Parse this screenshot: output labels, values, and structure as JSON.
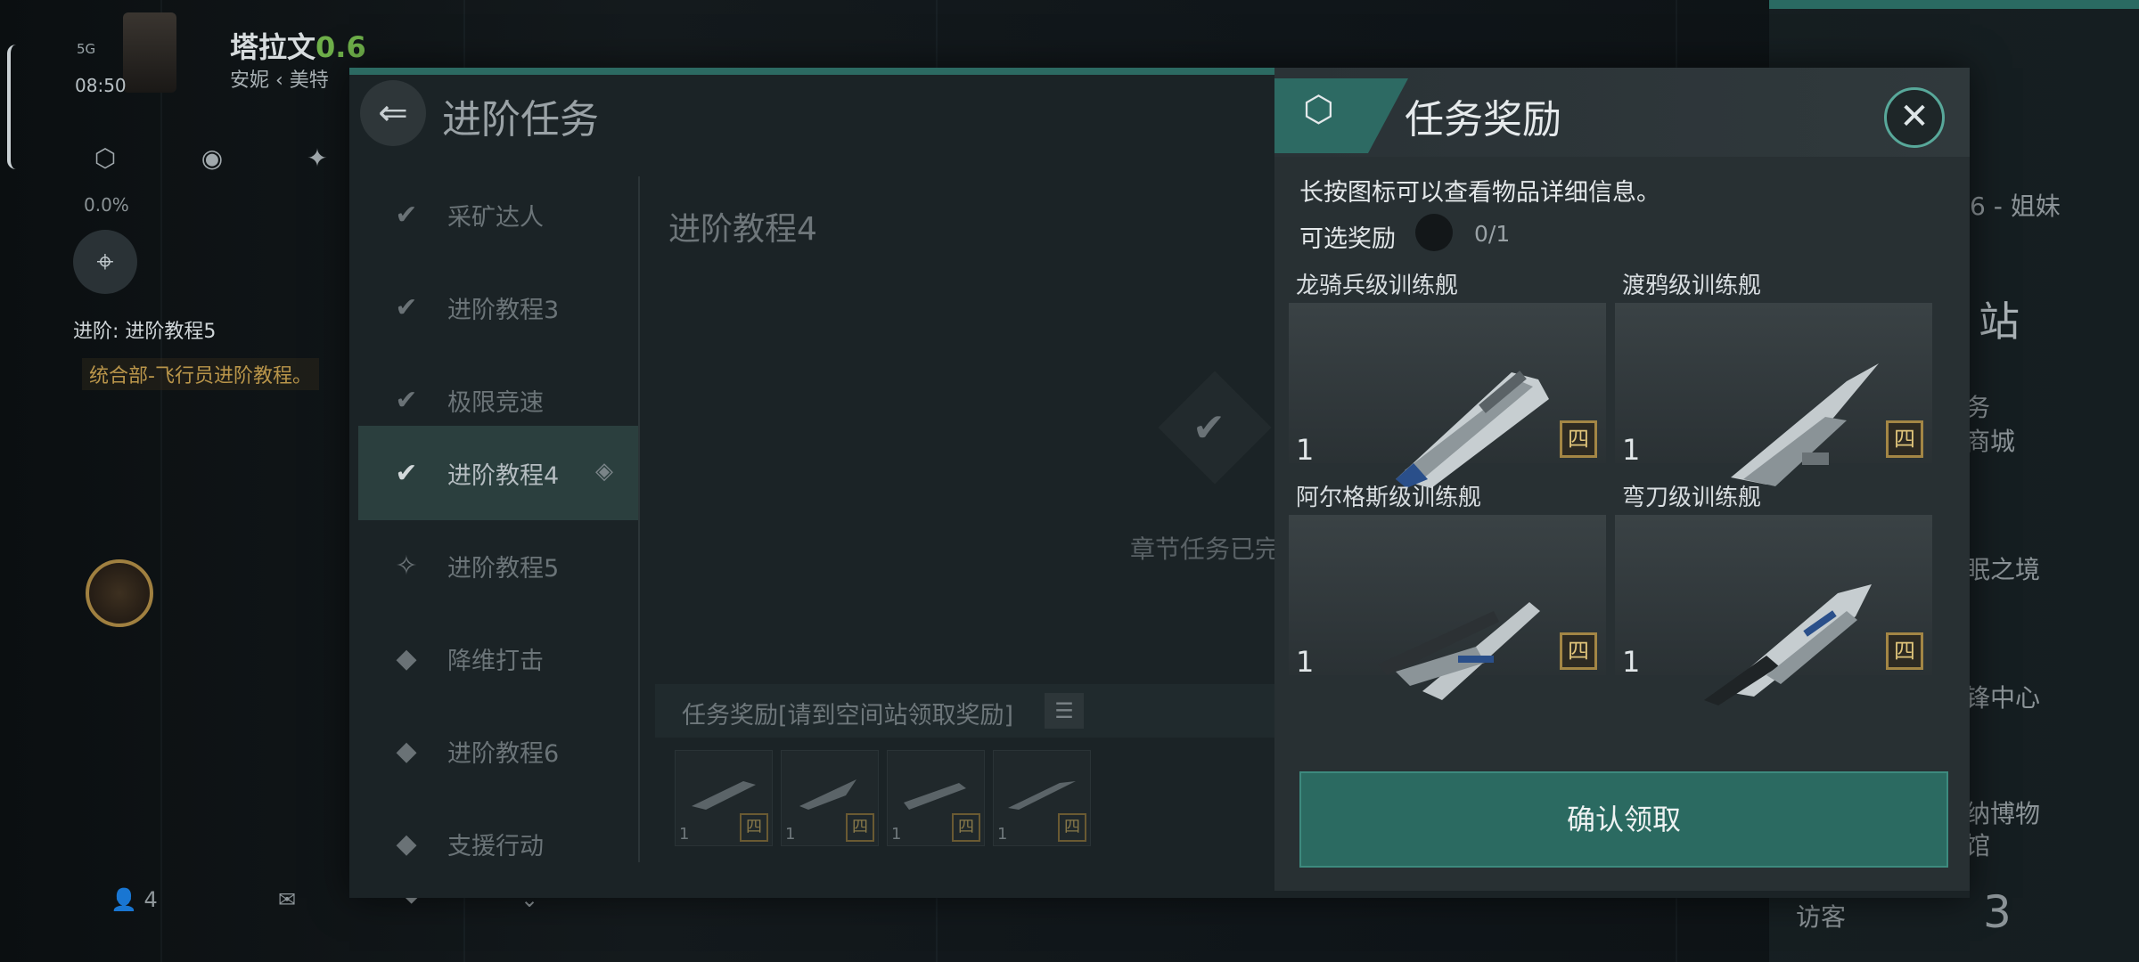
{
  "hud": {
    "signal": "5G",
    "time": "08:50",
    "player_name": "塔拉文",
    "security": "0.6",
    "location": "安妮 ‹ 美特",
    "progress": "0.0%",
    "tracker_title": "进阶: 进阶教程5",
    "tracker_desc": "统合部-飞行员进阶教程。"
  },
  "bottom_bar": {
    "people_count": "4"
  },
  "right_bg": {
    "text_1": "6 - 姐妹",
    "text_2": "站",
    "text_3": "务",
    "text_4": "商城",
    "text_5": "眠之境",
    "text_6": "锋中心",
    "text_7": "纳博物",
    "text_8": "馆",
    "visitor": "访客",
    "count": "3"
  },
  "dialog": {
    "title": "进阶任务",
    "chapter_title": "进阶教程4",
    "chapter_done": "章节任务已完",
    "reward_bar": "任务奖励[请到空间站领取奖励]",
    "tasks": [
      {
        "label": "采矿达人"
      },
      {
        "label": "进阶教程3"
      },
      {
        "label": "极限竞速"
      },
      {
        "label": "进阶教程4"
      },
      {
        "label": "进阶教程5"
      },
      {
        "label": "降维打击"
      },
      {
        "label": "进阶教程6"
      },
      {
        "label": "支援行动"
      }
    ],
    "mini_rewards": [
      {
        "qty": "1",
        "tier": "四"
      },
      {
        "qty": "1",
        "tier": "四"
      },
      {
        "qty": "1",
        "tier": "四"
      },
      {
        "qty": "1",
        "tier": "四"
      }
    ]
  },
  "reward_panel": {
    "title": "任务奖励",
    "hint": "长按图标可以查看物品详细信息。",
    "optional_label": "可选奖励",
    "optional_count": "0/1",
    "confirm": "确认领取",
    "items": [
      {
        "name": "龙骑兵级训练舰",
        "qty": "1",
        "tier": "四"
      },
      {
        "name": "渡鸦级训练舰",
        "qty": "1",
        "tier": "四"
      },
      {
        "name": "阿尔格斯级训练舰",
        "qty": "1",
        "tier": "四"
      },
      {
        "name": "弯刀级训练舰",
        "qty": "1",
        "tier": "四"
      }
    ]
  },
  "colors": {
    "accent": "#2b6a61",
    "security_green": "#6fb04a",
    "tier_gold": "#a38645"
  }
}
